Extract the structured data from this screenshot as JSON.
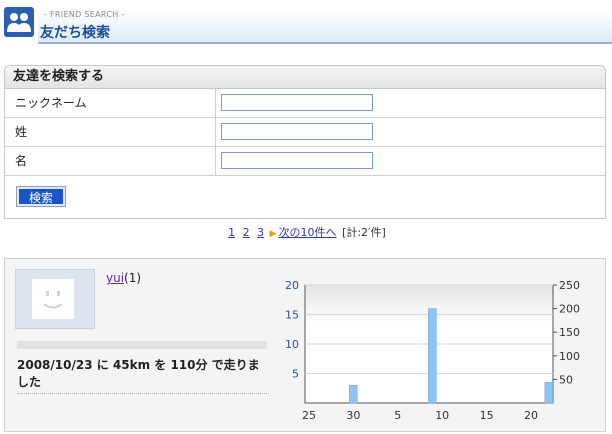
{
  "header": {
    "subtitle": "- FRIEND SEARCH -",
    "title": "友だち検索"
  },
  "search": {
    "heading": "友達を検索する",
    "fields": [
      {
        "label": "ニックネーム",
        "value": ""
      },
      {
        "label": "姓",
        "value": ""
      },
      {
        "label": "名",
        "value": ""
      }
    ],
    "button_label": "検索"
  },
  "pager": {
    "pages": [
      "1",
      "2",
      "3"
    ],
    "next_label": "次の10件へ",
    "total_text": "[計:2′件]"
  },
  "result": {
    "user_name": "yui",
    "user_count": "(1)",
    "message": "2008/10/23 に 45km を 110分 で走りました"
  },
  "colors": {
    "accent": "#1d4f98",
    "button": "#1a55c8",
    "bar": "#8fc3f0"
  },
  "chart_data": {
    "type": "bar",
    "x_ticks": [
      "25",
      "30",
      "5",
      "10",
      "15",
      "20"
    ],
    "y_left_ticks": [
      "5",
      "10",
      "15",
      "20"
    ],
    "y_right_ticks": [
      "50",
      "100",
      "150",
      "200",
      "250"
    ],
    "ylim_left": [
      0,
      20
    ],
    "ylim_right": [
      0,
      250
    ],
    "bars": [
      {
        "pos": 30.8,
        "value": 3
      },
      {
        "pos": 40.3,
        "value": 16
      },
      {
        "pos": 54.3,
        "value": 3.5
      }
    ],
    "x_domain": [
      25,
      54.8
    ],
    "grid": true
  }
}
